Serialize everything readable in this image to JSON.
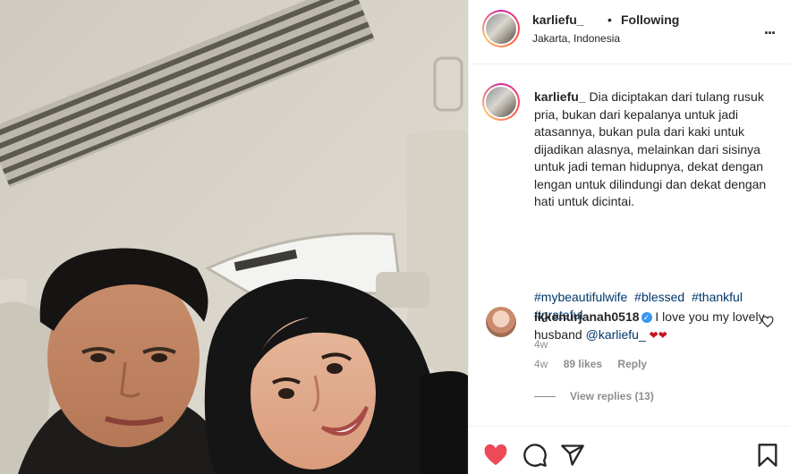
{
  "header": {
    "username": "karliefu_",
    "separator": "•",
    "follow_status": "Following",
    "location": "Jakarta, Indonesia",
    "more_label": "..."
  },
  "caption": {
    "username": "karliefu_",
    "text": "Dia diciptakan dari tulang rusuk pria, bukan dari kepalanya untuk jadi atasannya, bukan pula dari kaki untuk dijadikan alasnya, melainkan dari sisinya untuk jadi teman hidupnya, dekat dengan lengan untuk dilindungi dan dekat dengan hati untuk dicintai.",
    "hashtags": [
      "#mybeautifulwife",
      "#blessed",
      "#thankful",
      "#grateful"
    ],
    "age": "4w"
  },
  "comment": {
    "username": "ikkenurjanah0518",
    "verified_mark": "✓",
    "text_before": "I love you my lovely husband",
    "mention": "@karliefu_",
    "hearts": "❤❤",
    "age": "4w",
    "likes": "89 likes",
    "reply_label": "Reply"
  },
  "view_replies": "View replies (13)",
  "colors": {
    "like_red": "#ed4956",
    "link_blue": "#00376b",
    "muted": "#8e8e8e",
    "verified_blue": "#3897f0"
  },
  "icons": {
    "like": "heart-filled-icon",
    "comment": "comment-icon",
    "share": "paper-plane-icon",
    "save": "bookmark-icon"
  }
}
